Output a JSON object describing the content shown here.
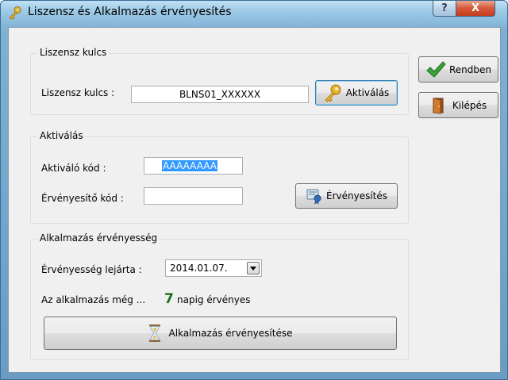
{
  "window": {
    "title": "Liszensz és Alkalmazás érvényesítés",
    "help_label": "?",
    "close_label": "X"
  },
  "license_group": {
    "legend": "Liszensz kulcs",
    "field_label": "Liszensz kulcs :",
    "field_value": "BLNS01_XXXXXX",
    "activate_button": "Aktiválás"
  },
  "activation_group": {
    "legend": "Aktiválás",
    "activation_code_label": "Aktiváló kód :",
    "activation_code_value": "AAAAAAAA",
    "validation_code_label": "Érvényesítő kód :",
    "validation_code_value": "",
    "validate_button": "Érvényesítés"
  },
  "app_validity_group": {
    "legend": "Alkalmazás érvényesség",
    "expiry_label": "Érvényesség lejárta :",
    "expiry_value": "2014.01.07.",
    "remaining_prefix": "Az alkalmazás még ...",
    "remaining_days": "7",
    "remaining_suffix": "napig érvényes",
    "validate_app_button": "Alkalmazás érvényesítése"
  },
  "side_buttons": {
    "ok": "Rendben",
    "exit": "Kilépés"
  },
  "colors": {
    "selection": "#3399ff",
    "days_green": "#1a6e1a",
    "close_red": "#c53d1e"
  },
  "icons": {
    "title": "key-icon",
    "activate": "key-icon",
    "validate": "certificate-icon",
    "app_validate": "hourglass-icon",
    "ok": "checkmark-icon",
    "exit": "door-exit-icon"
  }
}
